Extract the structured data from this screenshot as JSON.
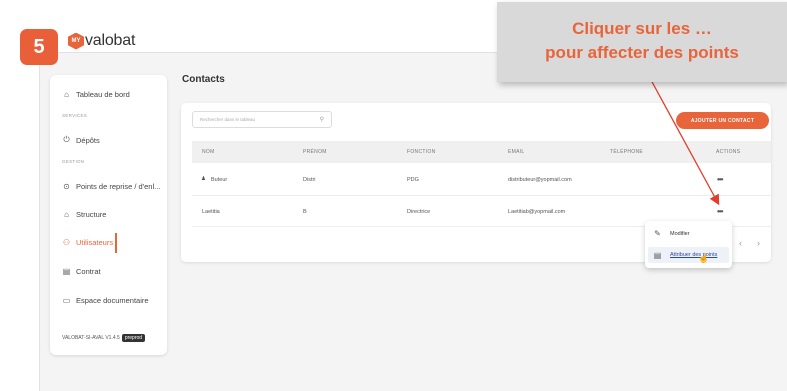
{
  "step_number": "5",
  "brand": {
    "logo_mark": "MY",
    "name": "valobat",
    "color": "#e8643a"
  },
  "sidebar": {
    "dashboard": "Tableau de bord",
    "section_services": "SERVICES",
    "depots": "Dépôts",
    "section_gestion": "GESTION",
    "points": "Points de reprise / d'enl...",
    "structure": "Structure",
    "users": "Utilisateurs",
    "contract": "Contrat",
    "documents": "Espace documentaire",
    "version": "VALOBAT-SI-AVAL V1.4.5",
    "env_badge": "preprod"
  },
  "main": {
    "title": "Contacts",
    "search_placeholder": "Rechercher dans le tableau",
    "add_button": "AJOUTER UN CONTACT",
    "columns": [
      "NOM",
      "PRÉNOM",
      "FONCTION",
      "EMAIL",
      "TÉLÉPHONE",
      "ACTIONS"
    ],
    "rows": [
      {
        "nom": "Buteur",
        "prenom": "Distri",
        "fonction": "PDG",
        "email": "distributeur@yopmail.com",
        "telephone": "",
        "actions": "•••"
      },
      {
        "nom": "Laetitia",
        "prenom": "B",
        "fonction": "Directrice",
        "email": "Laetitiab@yopmail.com",
        "telephone": "",
        "actions": "•••"
      }
    ],
    "pager_prev": "‹",
    "pager_next": "›"
  },
  "row_menu": {
    "edit": "Modifier",
    "assign_points": "Attribuer des points"
  },
  "callout": {
    "line1": "Cliquer sur les …",
    "line2": "pour affecter des points"
  }
}
